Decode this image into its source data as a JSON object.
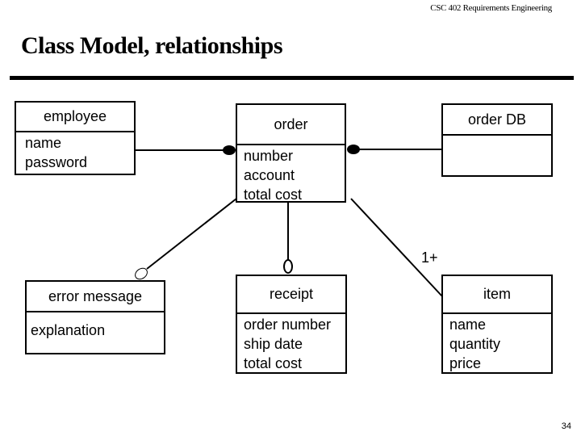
{
  "header": {
    "course": "CSC 402 Requirements Engineering"
  },
  "slide": {
    "title": "Class Model, relationships",
    "page_number": "34"
  },
  "classes": {
    "employee": {
      "name": "employee",
      "attributes": [
        "name",
        "password"
      ]
    },
    "order": {
      "name": "order",
      "attributes": [
        "number",
        "account",
        "total cost"
      ]
    },
    "order_db": {
      "name": "order DB",
      "attributes": []
    },
    "error_message": {
      "name": "error message",
      "attributes": [
        "explanation"
      ]
    },
    "receipt": {
      "name": "receipt",
      "attributes": [
        "order number",
        "ship date",
        "total cost"
      ]
    },
    "item": {
      "name": "item",
      "attributes": [
        "name",
        "quantity",
        "price"
      ]
    }
  },
  "relationships": [
    {
      "from": "employee",
      "to": "order",
      "end_marker": "filled-dot"
    },
    {
      "from": "order",
      "to": "order DB",
      "end_marker": "filled-dot"
    },
    {
      "from": "order",
      "to": "error message",
      "end_marker": "hollow-dot"
    },
    {
      "from": "order",
      "to": "receipt",
      "end_marker": "hollow-dot"
    },
    {
      "from": "order",
      "to": "item",
      "multiplicity": "1+"
    }
  ]
}
